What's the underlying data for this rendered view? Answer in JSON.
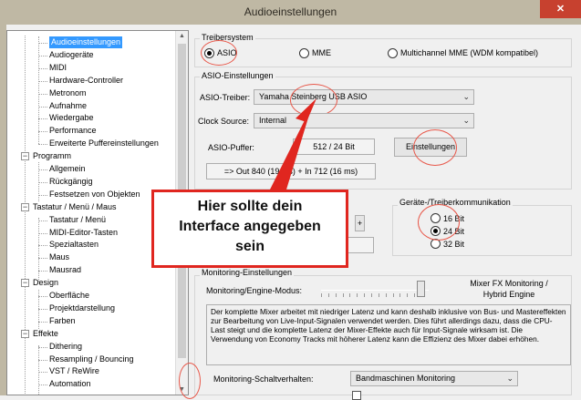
{
  "window": {
    "title": "Audioeinstellungen",
    "close_glyph": "✕"
  },
  "tree": {
    "items": [
      {
        "label": "Audioeinstellungen",
        "selected": true
      },
      {
        "label": "Audiogeräte"
      },
      {
        "label": "MIDI"
      },
      {
        "label": "Hardware-Controller"
      },
      {
        "label": "Metronom"
      },
      {
        "label": "Aufnahme"
      },
      {
        "label": "Wiedergabe"
      },
      {
        "label": "Performance"
      },
      {
        "label": "Erweiterte Puffereinstellungen"
      },
      {
        "label": "Programm",
        "group": true
      },
      {
        "label": "Allgemein"
      },
      {
        "label": "Rückgängig"
      },
      {
        "label": "Festsetzen von Objekten"
      },
      {
        "label": "Tastatur / Menü / Maus",
        "group": true
      },
      {
        "label": "Tastatur / Menü"
      },
      {
        "label": "MIDI-Editor-Tasten"
      },
      {
        "label": "Spezialtasten"
      },
      {
        "label": "Maus"
      },
      {
        "label": "Mausrad"
      },
      {
        "label": "Design",
        "group": true
      },
      {
        "label": "Oberfläche"
      },
      {
        "label": "Projektdarstellung"
      },
      {
        "label": "Farben"
      },
      {
        "label": "Effekte",
        "group": true
      },
      {
        "label": "Dithering"
      },
      {
        "label": "Resampling / Bouncing"
      },
      {
        "label": "VST / ReWire"
      },
      {
        "label": "Automation"
      }
    ]
  },
  "driver": {
    "group_label": "Treibersystem",
    "options": [
      {
        "label": "ASIO",
        "checked": true
      },
      {
        "label": "MME",
        "checked": false
      },
      {
        "label": "Multichannel MME (WDM kompatibel)",
        "checked": false
      }
    ]
  },
  "asio": {
    "group_label": "ASIO-Einstellungen",
    "driver_label": "ASIO-Treiber:",
    "driver_value": "Yamaha Steinberg USB ASIO",
    "clock_label": "Clock Source:",
    "clock_value": "Internal",
    "buffer_label": "ASIO-Puffer:",
    "buffer_value": "512 / 24 Bit",
    "settings_button": "Einstellungen",
    "latency": "=> Out 840 (19 ms) + In 712 (16 ms)"
  },
  "bitdepth": {
    "group_label": "Geräte-/Treiberkommunikation",
    "options": [
      {
        "label": "16 Bit",
        "checked": false
      },
      {
        "label": "24 Bit",
        "checked": true
      },
      {
        "label": "32 Bit",
        "checked": false
      }
    ]
  },
  "callout": {
    "lines": [
      "Hier sollte dein",
      "Interface angegeben",
      "sein"
    ]
  },
  "monitoring": {
    "group_label": "Monitoring-Einstellungen",
    "mode_label": "Monitoring/Engine-Modus:",
    "mode_value_line1": "Mixer FX Monitoring /",
    "mode_value_line2": "Hybrid Engine",
    "slider_level": 1.0,
    "description": "Der komplette Mixer arbeitet mit niedriger Latenz und kann deshalb inklusive von Bus- und Mastereffekten zur Bearbeitung von Live-Input-Signalen verwendet werden. Dies führt allerdings dazu, dass die CPU-Last steigt und die komplette Latenz der Mixer-Effekte auch für Input-Signale wirksam ist. Die Verwendung von Economy Tracks mit höherer Latenz kann die Effizienz des Mixer dabei erhöhen.",
    "switch_label": "Monitoring-Schaltverhalten:",
    "switch_value": "Bandmaschinen Monitoring"
  },
  "colors": {
    "highlight": "#3399ff",
    "callout_border": "#e0261f",
    "circle": "#e8584a"
  }
}
